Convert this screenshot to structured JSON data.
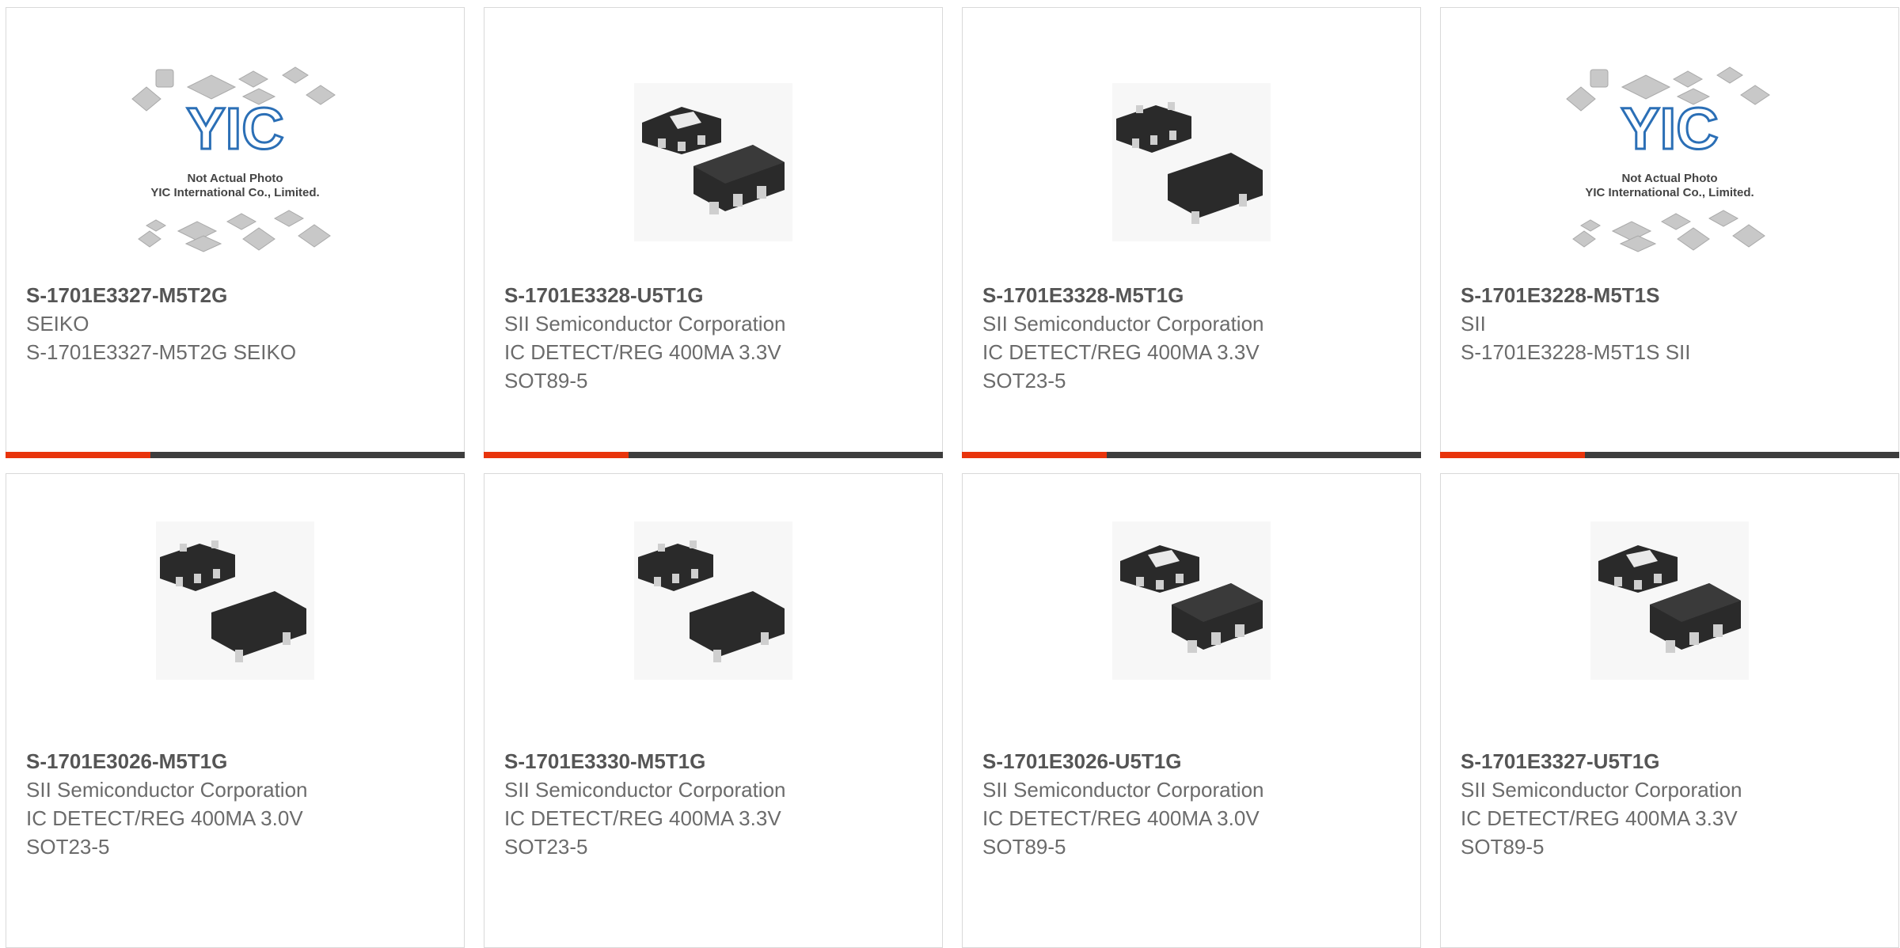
{
  "products": [
    {
      "part": "S-1701E3327-M5T2G",
      "lines": [
        "SEIKO",
        "S-1701E3327-M5T2G SEIKO"
      ],
      "image": "placeholder-logo",
      "placeholder": {
        "brand": "YIC",
        "note1": "Not Actual Photo",
        "note2": "YIC International Co., Limited."
      }
    },
    {
      "part": "S-1701E3328-U5T1G",
      "lines": [
        "SII Semiconductor Corporation",
        "IC DETECT/REG 400MA 3.3V",
        "SOT89-5"
      ],
      "image": "sot89-chip"
    },
    {
      "part": "S-1701E3328-M5T1G",
      "lines": [
        "SII Semiconductor Corporation",
        "IC DETECT/REG 400MA 3.3V",
        "SOT23-5"
      ],
      "image": "sot23-chip"
    },
    {
      "part": "S-1701E3228-M5T1S",
      "lines": [
        "SII",
        "S-1701E3228-M5T1S SII"
      ],
      "image": "placeholder-logo",
      "placeholder": {
        "brand": "YIC",
        "note1": "Not Actual Photo",
        "note2": "YIC International Co., Limited."
      }
    },
    {
      "part": "S-1701E3026-M5T1G",
      "lines": [
        "SII Semiconductor Corporation",
        "IC DETECT/REG 400MA 3.0V",
        "SOT23-5"
      ],
      "image": "sot23-chip"
    },
    {
      "part": "S-1701E3330-M5T1G",
      "lines": [
        "SII Semiconductor Corporation",
        "IC DETECT/REG 400MA 3.3V",
        "SOT23-5"
      ],
      "image": "sot23-chip"
    },
    {
      "part": "S-1701E3026-U5T1G",
      "lines": [
        "SII Semiconductor Corporation",
        "IC DETECT/REG 400MA 3.0V",
        "SOT89-5"
      ],
      "image": "sot89-chip"
    },
    {
      "part": "S-1701E3327-U5T1G",
      "lines": [
        "SII Semiconductor Corporation",
        "IC DETECT/REG 400MA 3.3V",
        "SOT89-5"
      ],
      "image": "sot89-chip"
    }
  ],
  "colors": {
    "accent": "#e8340c",
    "bar": "#3d3d3d",
    "logo": "#2b6fb6"
  }
}
